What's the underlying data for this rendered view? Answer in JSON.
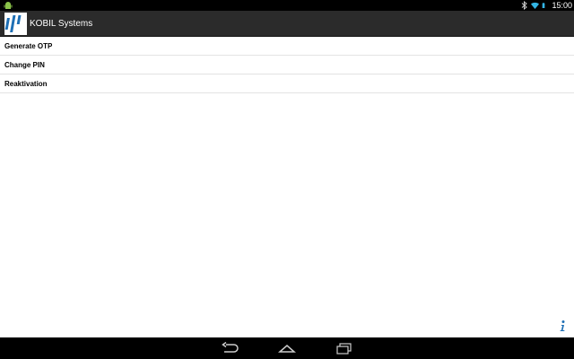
{
  "status_bar": {
    "time": "15:00",
    "icons": [
      "android-notification-icon",
      "bluetooth-icon",
      "wifi-icon",
      "battery-icon"
    ]
  },
  "app_bar": {
    "title": "KOBIL Systems",
    "logo": "kobil-logo"
  },
  "menu": {
    "items": [
      {
        "label": "Generate OTP"
      },
      {
        "label": "Change PIN"
      },
      {
        "label": "Reaktivation"
      }
    ]
  },
  "footer": {
    "info_icon": "info-icon"
  },
  "nav_bar": {
    "buttons": [
      "back-icon",
      "home-icon",
      "recent-apps-icon"
    ]
  },
  "colors": {
    "action_bar": "#2b2b2b",
    "status_bar": "#000000",
    "nav_bar": "#000000",
    "accent_blue": "#1e6fb5"
  }
}
